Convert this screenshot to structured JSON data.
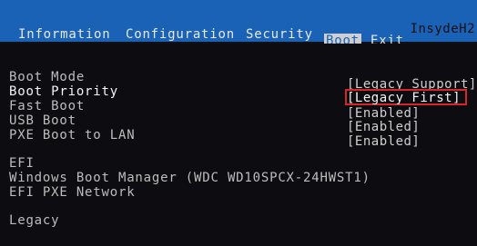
{
  "header": {
    "vendor": "InsydeH2"
  },
  "menu": {
    "tabs": [
      {
        "label": "Information"
      },
      {
        "label": "Configuration"
      },
      {
        "label": "Security"
      },
      {
        "label": "Boot"
      },
      {
        "label": "Exit"
      }
    ],
    "active_tab": "Boot"
  },
  "boot": {
    "settings": [
      {
        "label": "Boot Mode",
        "value": "[Legacy Support]"
      },
      {
        "label": "Boot Priority",
        "value": "[Legacy First]"
      },
      {
        "label": "Fast Boot",
        "value": "[Enabled]"
      },
      {
        "label": "USB Boot",
        "value": "[Enabled]"
      },
      {
        "label": "PXE Boot to LAN",
        "value": "[Enabled]"
      }
    ],
    "selected_setting": "Boot Priority",
    "efi_section": {
      "heading": "EFI",
      "entries": [
        "Windows Boot Manager (WDC WD10SPCX-24HWST1)",
        "EFI PXE Network"
      ]
    },
    "legacy_section": {
      "heading": "Legacy"
    }
  },
  "colors": {
    "frame_blue": "#1a62b6",
    "highlight_red": "#d6262a",
    "background": "#0d0d11"
  }
}
